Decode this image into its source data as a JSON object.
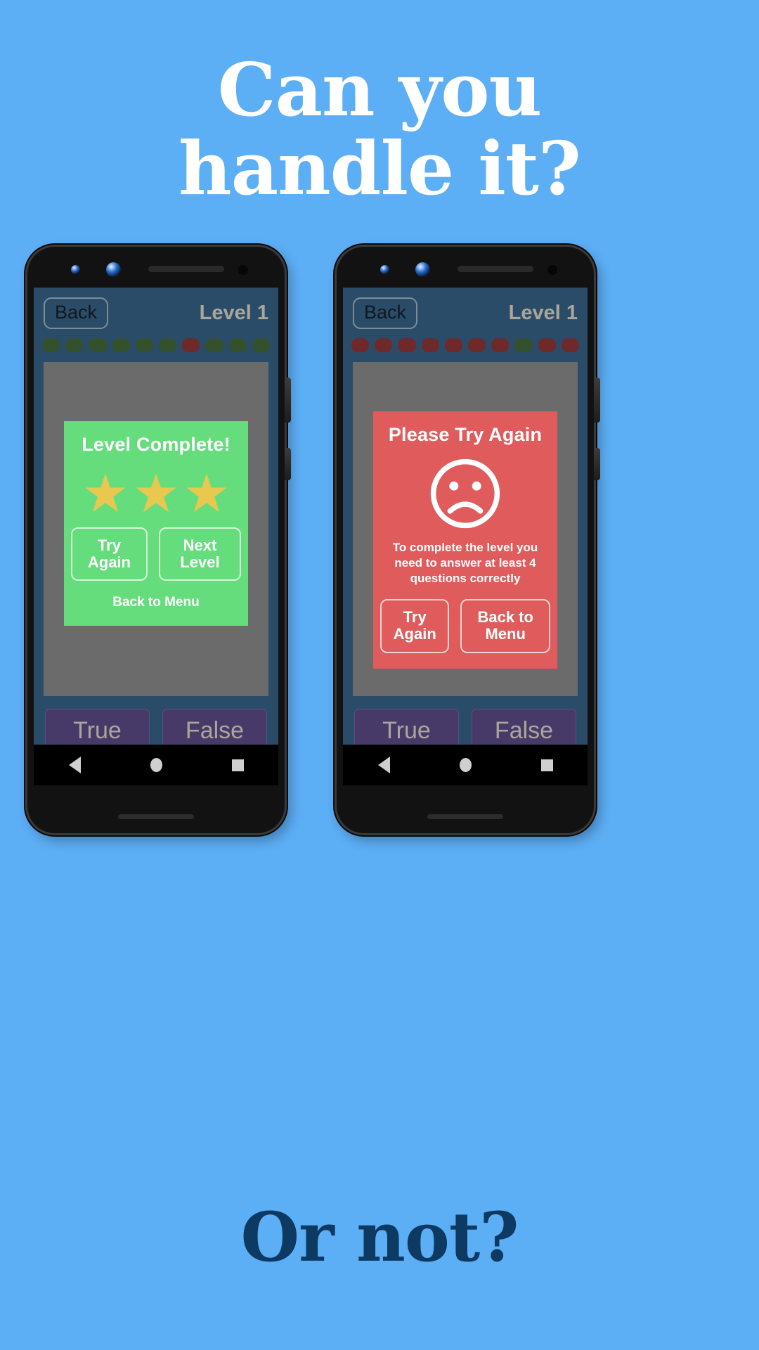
{
  "page": {
    "background_color": "#5caef5",
    "headline_line1": "Can you",
    "headline_line2": "handle it?",
    "headline_color": "#ffffff",
    "footer_text": "Or not?",
    "footer_color": "#0d3a63"
  },
  "phones": [
    {
      "id": "left",
      "appbar": {
        "back_label": "Back",
        "level_label": "Level 1"
      },
      "progress": {
        "states": [
          "correct",
          "correct",
          "correct",
          "correct",
          "correct",
          "correct",
          "wrong",
          "correct",
          "correct",
          "correct"
        ],
        "correct_color": "#33512d",
        "wrong_color": "#6e2a2a"
      },
      "dialog": {
        "kind": "success",
        "background": "#66dd7c",
        "title": "Level Complete!",
        "stars": 3,
        "star_color": "#e8c84f",
        "buttons": [
          "Try Again",
          "Next Level"
        ],
        "link_label": "Back to Menu"
      },
      "answers": [
        "True",
        "False"
      ],
      "navbar": [
        "back-triangle-icon",
        "home-circle-icon",
        "recents-square-icon"
      ]
    },
    {
      "id": "right",
      "appbar": {
        "back_label": "Back",
        "level_label": "Level 1"
      },
      "progress": {
        "states": [
          "wrong",
          "wrong",
          "wrong",
          "wrong",
          "wrong",
          "wrong",
          "wrong",
          "correct",
          "wrong",
          "wrong"
        ],
        "correct_color": "#33512d",
        "wrong_color": "#6e2a2a"
      },
      "dialog": {
        "kind": "fail",
        "background": "#e05c5c",
        "title": "Please Try Again",
        "face_icon": "sad-face-icon",
        "message": "To complete the level you need to answer at least 4 questions correctly",
        "buttons": [
          "Try Again",
          "Back to Menu"
        ]
      },
      "answers": [
        "True",
        "False"
      ],
      "navbar": [
        "back-triangle-icon",
        "home-circle-icon",
        "recents-square-icon"
      ]
    }
  ]
}
